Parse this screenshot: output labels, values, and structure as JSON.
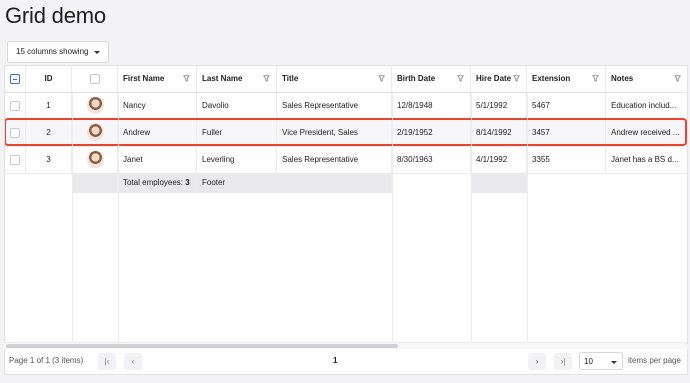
{
  "page_title": "Grid demo",
  "toolbar": {
    "columns_label": "15 columns showing"
  },
  "columns": [
    {
      "key": "select",
      "label": ""
    },
    {
      "key": "id",
      "label": "ID"
    },
    {
      "key": "photo",
      "label": ""
    },
    {
      "key": "first_name",
      "label": "First Name"
    },
    {
      "key": "last_name",
      "label": "Last Name"
    },
    {
      "key": "title",
      "label": "Title"
    },
    {
      "key": "birth_date",
      "label": "Birth Date"
    },
    {
      "key": "hire_date",
      "label": "Hire Date"
    },
    {
      "key": "extension",
      "label": "Extension"
    },
    {
      "key": "notes",
      "label": "Notes"
    }
  ],
  "rows": [
    {
      "id": "1",
      "first_name": "Nancy",
      "last_name": "Davolio",
      "title": "Sales Representative",
      "birth_date": "12/8/1948",
      "hire_date": "5/1/1992",
      "extension": "5467",
      "notes": "Education includ..."
    },
    {
      "id": "2",
      "first_name": "Andrew",
      "last_name": "Fuller",
      "title": "Vice President, Sales",
      "birth_date": "2/19/1952",
      "hire_date": "8/14/1992",
      "extension": "3457",
      "notes": "Andrew received ..."
    },
    {
      "id": "3",
      "first_name": "Janet",
      "last_name": "Leverling",
      "title": "Sales Representative",
      "birth_date": "8/30/1963",
      "hire_date": "4/1/1992",
      "extension": "3355",
      "notes": "Janet has a BS d..."
    }
  ],
  "footer": {
    "total_label": "Total employees:",
    "total_value": "3",
    "footer_text": "Footer"
  },
  "pager": {
    "info": "Page 1 of 1 (3 items)",
    "current_page": "1",
    "page_size": "10",
    "page_size_label": "items per page"
  }
}
